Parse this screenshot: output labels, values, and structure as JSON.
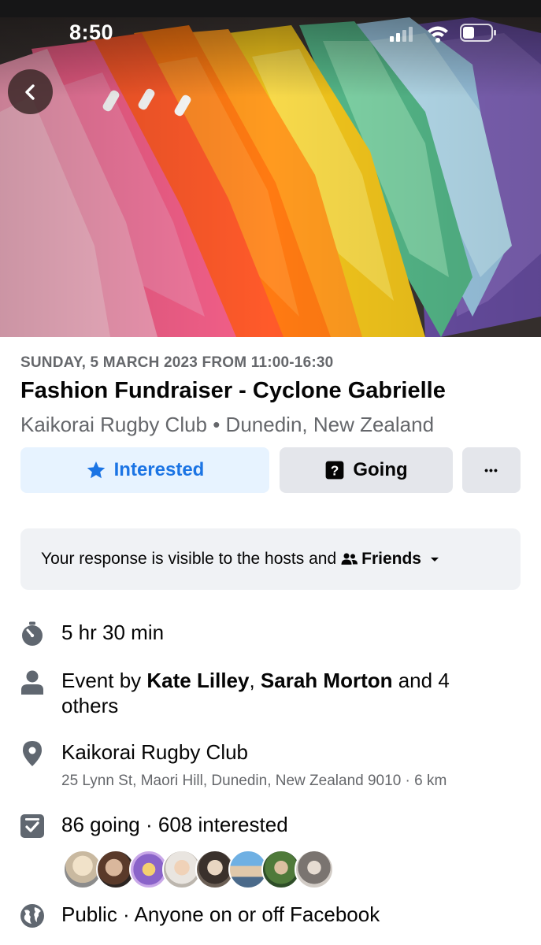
{
  "status_bar": {
    "time": "8:50"
  },
  "header": {
    "back_icon": "chevron-left-icon"
  },
  "event": {
    "date_line": "SUNDAY, 5 MARCH 2023 FROM 11:00-16:30",
    "title": "Fashion Fundraiser - Cyclone Gabrielle",
    "location_line": "Kaikorai Rugby Club • Dunedin, New Zealand"
  },
  "actions": {
    "interested_label": "Interested",
    "going_label": "Going",
    "more_label": "•••",
    "accent_color": "#1b74e4"
  },
  "visibility": {
    "text": "Your response is visible to the hosts and",
    "audience": "Friends"
  },
  "details": {
    "duration": "5 hr 30 min",
    "hosts_prefix": "Event by ",
    "host_1": "Kate Lilley",
    "host_sep": ", ",
    "host_2": "Sarah Morton",
    "hosts_suffix": " and 4",
    "hosts_suffix_2": "others",
    "venue": "Kaikorai Rugby Club",
    "address": "25 Lynn St, Maori Hill, Dunedin, New Zealand 9010 · 6 km",
    "responses": "86 going · 608 interested",
    "privacy": "Public · Anyone on or off Facebook"
  },
  "attendee_avatars_count": 8
}
